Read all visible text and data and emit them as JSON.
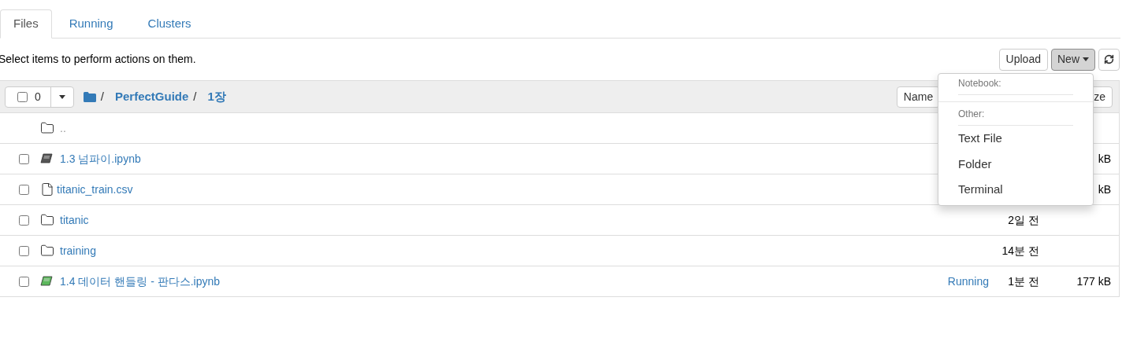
{
  "tabs": [
    {
      "label": "Files",
      "selected": true
    },
    {
      "label": "Running",
      "selected": false
    },
    {
      "label": "Clusters",
      "selected": false
    }
  ],
  "message": "Select items to perform actions on them.",
  "toolbar": {
    "buttons": [
      "Upload",
      "New"
    ]
  },
  "table": {
    "select_all_checked": false,
    "selection_count": "0",
    "breadcrumb": [
      "/",
      "PerfectGuide",
      "/",
      "1장"
    ],
    "header_buttons": [
      "Name",
      "ze"
    ],
    "rows": [
      {
        "kind": "parent",
        "name": ".."
      },
      {
        "kind": "notebook",
        "name": "1.3 넘파이.ipynb",
        "checked": false,
        "running": false,
        "size": "kB"
      },
      {
        "kind": "file",
        "name": "titanic_train.csv",
        "checked": false,
        "size": "kB"
      },
      {
        "kind": "folder",
        "name": "titanic",
        "checked": false,
        "modified": "2일 전"
      },
      {
        "kind": "folder",
        "name": "training",
        "checked": false,
        "modified": "14분 전"
      },
      {
        "kind": "notebook",
        "name": "1.4 데이터 핸들링 - 판다스.ipynb",
        "checked": false,
        "running": true,
        "status": "Running",
        "modified": "1분 전",
        "size": "177 kB"
      }
    ]
  },
  "new_menu": {
    "sections": [
      {
        "header": "Notebook:"
      },
      {
        "header": "Other:",
        "items": [
          "Text File",
          "Folder",
          "Terminal"
        ]
      }
    ]
  }
}
